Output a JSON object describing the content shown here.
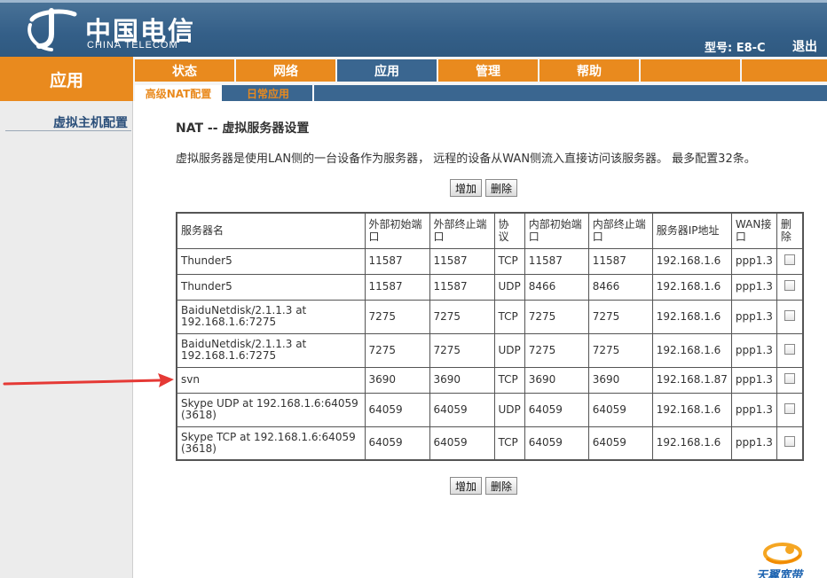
{
  "header": {
    "logo_cn": "中国电信",
    "logo_en": "CHINA TELECOM",
    "model": "型号: E8-C",
    "logout": "退出"
  },
  "section_title": "应用",
  "main_nav": [
    "状态",
    "网络",
    "应用",
    "管理",
    "帮助",
    "",
    ""
  ],
  "sub_nav": [
    "高级NAT配置",
    "日常应用"
  ],
  "sidebar": {
    "item": "虚拟主机配置"
  },
  "content": {
    "title": "NAT -- 虚拟服务器设置",
    "description": "虚拟服务器是使用LAN侧的一台设备作为服务器， 远程的设备从WAN侧流入直接访问该服务器。 最多配置32条。",
    "add_label": "增加",
    "delete_label": "删除"
  },
  "table": {
    "headers": {
      "name": "服务器名",
      "ext_start_1": "外部初始端",
      "ext_start_2": "口",
      "ext_end_1": "外部终止端",
      "ext_end_2": "口",
      "proto_1": "协",
      "proto_2": "议",
      "int_start_1": "内部初始端",
      "int_start_2": "口",
      "int_end_1": "内部终止端",
      "int_end_2": "口",
      "ip": "服务器IP地址",
      "wan_1": "WAN接",
      "wan_2": "口",
      "del_1": "删",
      "del_2": "除"
    },
    "rows": [
      {
        "name1": "Thunder5",
        "name2": "",
        "ext_start": "11587",
        "ext_end": "11587",
        "proto": "TCP",
        "int_start": "11587",
        "int_end": "11587",
        "ip": "192.168.1.6",
        "wan": "ppp1.3"
      },
      {
        "name1": "Thunder5",
        "name2": "",
        "ext_start": "11587",
        "ext_end": "11587",
        "proto": "UDP",
        "int_start": "8466",
        "int_end": "8466",
        "ip": "192.168.1.6",
        "wan": "ppp1.3"
      },
      {
        "name1": "BaiduNetdisk/2.1.1.3 at",
        "name2": "192.168.1.6:7275",
        "ext_start": "7275",
        "ext_end": "7275",
        "proto": "TCP",
        "int_start": "7275",
        "int_end": "7275",
        "ip": "192.168.1.6",
        "wan": "ppp1.3"
      },
      {
        "name1": "BaiduNetdisk/2.1.1.3 at",
        "name2": "192.168.1.6:7275",
        "ext_start": "7275",
        "ext_end": "7275",
        "proto": "UDP",
        "int_start": "7275",
        "int_end": "7275",
        "ip": "192.168.1.6",
        "wan": "ppp1.3"
      },
      {
        "name1": "svn",
        "name2": "",
        "ext_start": "3690",
        "ext_end": "3690",
        "proto": "TCP",
        "int_start": "3690",
        "int_end": "3690",
        "ip": "192.168.1.87",
        "wan": "ppp1.3"
      },
      {
        "name1": "Skype UDP at 192.168.1.6:64059",
        "name2": "(3618)",
        "ext_start": "64059",
        "ext_end": "64059",
        "proto": "UDP",
        "int_start": "64059",
        "int_end": "64059",
        "ip": "192.168.1.6",
        "wan": "ppp1.3"
      },
      {
        "name1": "Skype TCP at 192.168.1.6:64059",
        "name2": "(3618)",
        "ext_start": "64059",
        "ext_end": "64059",
        "proto": "TCP",
        "int_start": "64059",
        "int_end": "64059",
        "ip": "192.168.1.6",
        "wan": "ppp1.3"
      }
    ]
  },
  "footer": {
    "brand": "天翼宽带"
  },
  "colors": {
    "header_blue": "#345f88",
    "orange": "#e98a1e",
    "nav_blue": "#3a6690",
    "arrow_red": "#e53935"
  },
  "icons": {
    "logo": "china-telecom-logo",
    "arrow": "red-arrow-pointer",
    "brand": "tianyi-broadband-logo"
  }
}
